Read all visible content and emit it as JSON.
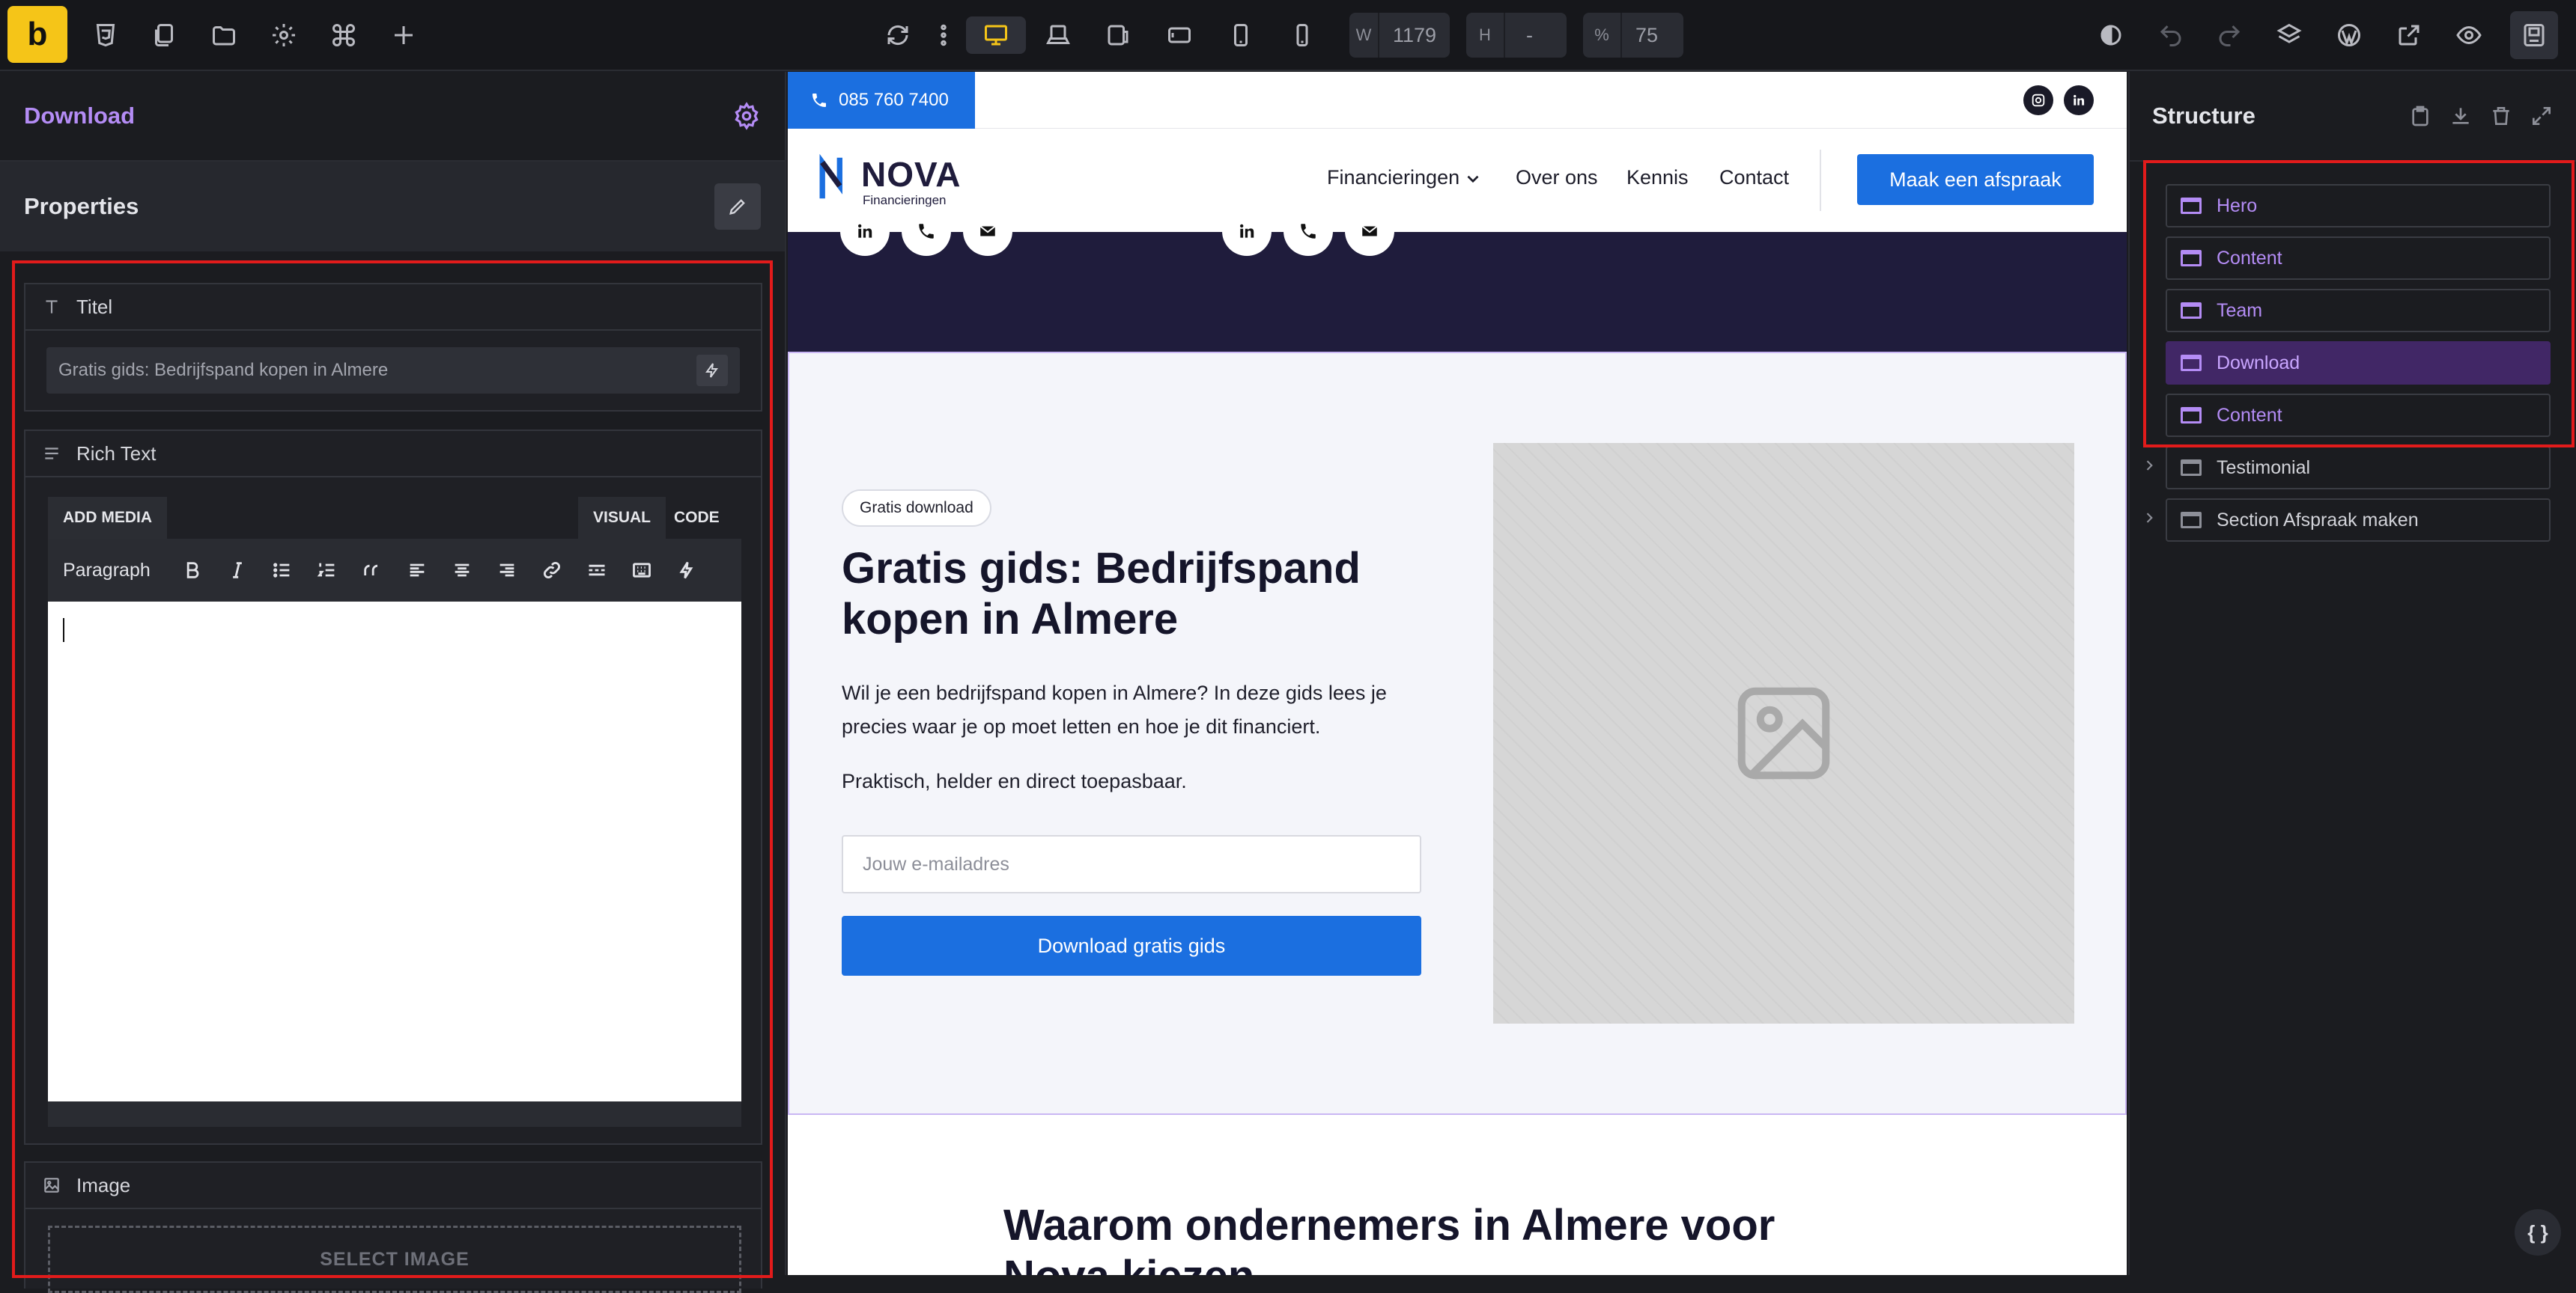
{
  "topbar": {
    "logo": "b",
    "width_label": "W",
    "width_value": "1179",
    "height_label": "H",
    "height_value": "-",
    "zoom_label": "%",
    "zoom_value": "75"
  },
  "left_panel": {
    "element_title": "Download",
    "properties_title": "Properties",
    "titel_label": "Titel",
    "titel_value": "Gratis gids: Bedrijfspand kopen in Almere",
    "richtext_label": "Rich Text",
    "add_media": "ADD MEDIA",
    "tab_visual": "VISUAL",
    "tab_code": "CODE",
    "format_select": "Paragraph",
    "image_label": "Image",
    "select_image": "SELECT IMAGE"
  },
  "site": {
    "phone": "085 760 7400",
    "logo_name": "NOVA",
    "logo_sub": "Financieringen",
    "nav_items": [
      "Financieringen",
      "Over ons",
      "Kennis",
      "Contact"
    ],
    "cta": "Maak een afspraak",
    "badge": "Gratis download",
    "heading": "Gratis gids: Bedrijfspand kopen in Almere",
    "paragraph1": "Wil je een bedrijfspand kopen in Almere? In deze gids lees je precies waar je op moet letten en hoe je dit financiert.",
    "paragraph2": "Praktisch, helder en direct toepasbaar.",
    "email_placeholder": "Jouw e-mailadres",
    "download_button": "Download gratis gids",
    "next_heading": "Waarom ondernemers in Almere voor Nova kiezen"
  },
  "structure": {
    "title": "Structure",
    "items": [
      {
        "label": "Hero"
      },
      {
        "label": "Content"
      },
      {
        "label": "Team"
      },
      {
        "label": "Download"
      },
      {
        "label": "Content"
      },
      {
        "label": "Testimonial"
      },
      {
        "label": "Section Afspraak maken"
      }
    ]
  },
  "code_button": "{ }",
  "colors": {
    "accent_purple": "#b48cf5",
    "brand_blue": "#1b6fe0",
    "highlight_red": "#e21b1b",
    "active_yellow": "#f5c518"
  }
}
